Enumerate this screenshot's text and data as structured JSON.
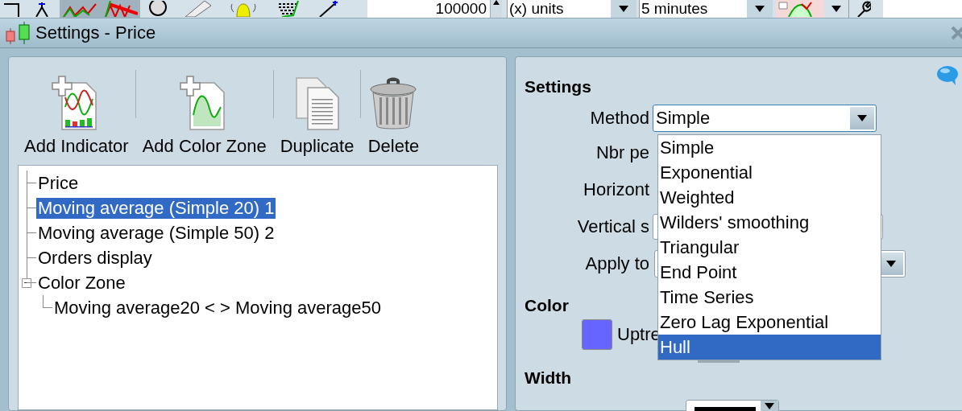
{
  "toolbar": {
    "quantity": "100000",
    "units": "(x) units",
    "timeframe": "5 minutes"
  },
  "window": {
    "title": "Settings - Price"
  },
  "actions": [
    {
      "kind": "add-indicator",
      "label": "Add Indicator"
    },
    {
      "kind": "add-zone",
      "label": "Add Color Zone"
    },
    {
      "kind": "duplicate",
      "label": "Duplicate"
    },
    {
      "kind": "delete",
      "label": "Delete"
    }
  ],
  "tree": [
    {
      "label": "Price",
      "selected": false
    },
    {
      "label": "Moving average (Simple 20) 1",
      "selected": true
    },
    {
      "label": "Moving average (Simple 50) 2",
      "selected": false
    },
    {
      "label": "Orders display",
      "selected": false
    },
    {
      "label": "Color Zone",
      "selected": false,
      "expanded": true,
      "children": [
        {
          "label": "Moving average20 < > Moving average50",
          "selected": false
        }
      ]
    }
  ],
  "settings": {
    "heading": "Settings",
    "fields": [
      {
        "label": "Method",
        "kind": "select",
        "value": "Simple",
        "expanded": true
      },
      {
        "label": "Nbr pe",
        "kind": "plain"
      },
      {
        "label": "Horizont",
        "kind": "plain"
      },
      {
        "label": "Vertical s",
        "kind": "spin"
      },
      {
        "label": "Apply to",
        "kind": "select"
      }
    ]
  },
  "method_options": [
    {
      "label": "Simple",
      "selected": false
    },
    {
      "label": "Exponential",
      "selected": false
    },
    {
      "label": "Weighted",
      "selected": false
    },
    {
      "label": "Wilders' smoothing",
      "selected": false
    },
    {
      "label": "Triangular",
      "selected": false
    },
    {
      "label": "End Point",
      "selected": false
    },
    {
      "label": "Time Series",
      "selected": false
    },
    {
      "label": "Zero Lag Exponential",
      "selected": false
    },
    {
      "label": "Hull",
      "selected": true
    }
  ],
  "color": {
    "heading": "Color",
    "items": [
      {
        "label": "Uptre",
        "color": "#6666ff"
      }
    ]
  },
  "width": {
    "heading": "Width"
  }
}
